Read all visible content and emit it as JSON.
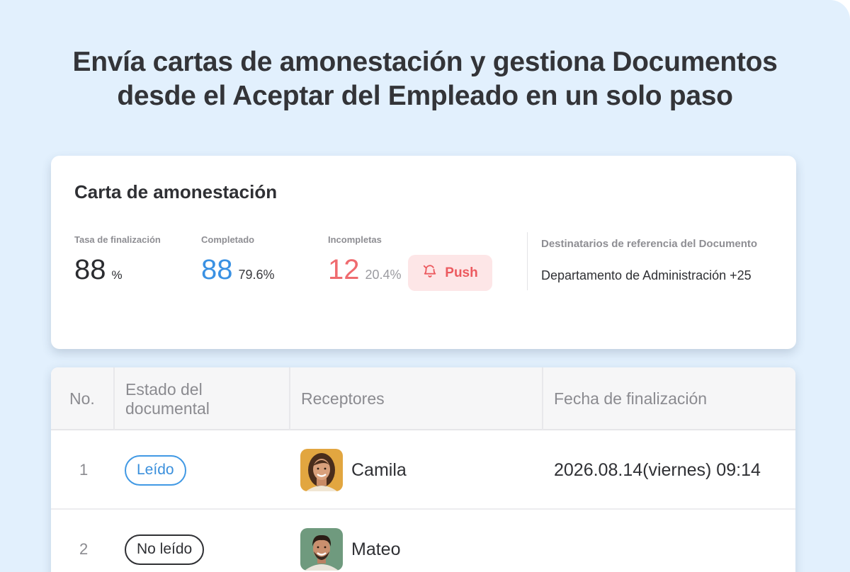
{
  "headline": {
    "line1": "Envía cartas de amonestación y gestiona Documentos",
    "line2": "desde el Aceptar del Empleado en un solo paso"
  },
  "card": {
    "title": "Carta de amonestación",
    "stats": {
      "completion_rate": {
        "label": "Tasa de finalización",
        "value": "88",
        "unit": "%"
      },
      "completed": {
        "label": "Completado",
        "value": "88",
        "percent": "79.6%"
      },
      "incomplete": {
        "label": "Incompletas",
        "value": "12",
        "percent": "20.4%"
      }
    },
    "push_button": {
      "label": "Push",
      "icon": "bell-icon"
    },
    "reference": {
      "label": "Destinatarios de referencia del Documento",
      "value": "Departamento de Administración +25"
    }
  },
  "table": {
    "headers": {
      "no": "No.",
      "status_line1": "Estado del",
      "status_line2": "documental",
      "receivers": "Receptores",
      "date": "Fecha de finalización"
    },
    "rows": [
      {
        "no": "1",
        "status": "Leído",
        "receiver": "Camila",
        "date": "2026.08.14(viernes) 09:14"
      },
      {
        "no": "2",
        "status": "No leído",
        "receiver": "Mateo",
        "date": ""
      }
    ]
  },
  "colors": {
    "background": "#e2f0fd",
    "accent_blue": "#3a91e3",
    "accent_red": "#ef6b6f",
    "push_bg": "#fde6e7"
  }
}
